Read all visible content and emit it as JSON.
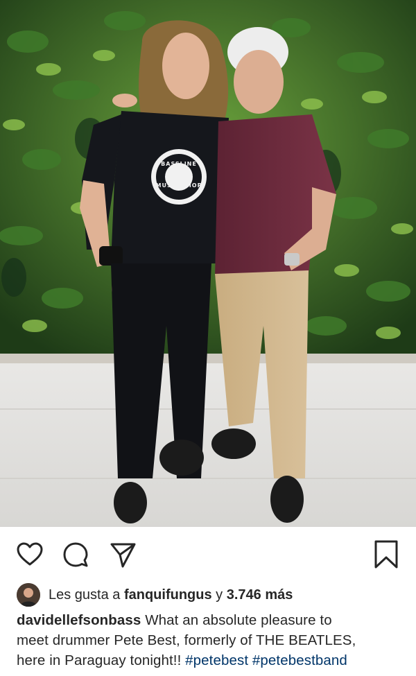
{
  "post": {
    "photo_icon": "concert-photo",
    "actions": {
      "like_icon": "heart-icon",
      "comment_icon": "comment-icon",
      "share_icon": "paper-plane-icon",
      "save_icon": "bookmark-icon"
    },
    "likes": {
      "prefix": "Les gusta a ",
      "user": "fanquifungus",
      "connector": " y ",
      "count": "3.746 más"
    },
    "caption": {
      "username": "davidellefsonbass",
      "line1_text": " What an absolute pleasure to",
      "line2_text": "meet drummer Pete Best, formerly of THE BEATLES,",
      "line3_text": "here in Paraguay tonight!! ",
      "hashtag1": "#petebest",
      "space": " ",
      "hashtag2": "#petebestband"
    },
    "shirt_logo": {
      "top_text": "BASSLINE",
      "bottom_text": "MUSIC SHOP"
    },
    "colors": {
      "text": "#262626",
      "hashtag": "#003569",
      "icon": "#262626"
    }
  }
}
